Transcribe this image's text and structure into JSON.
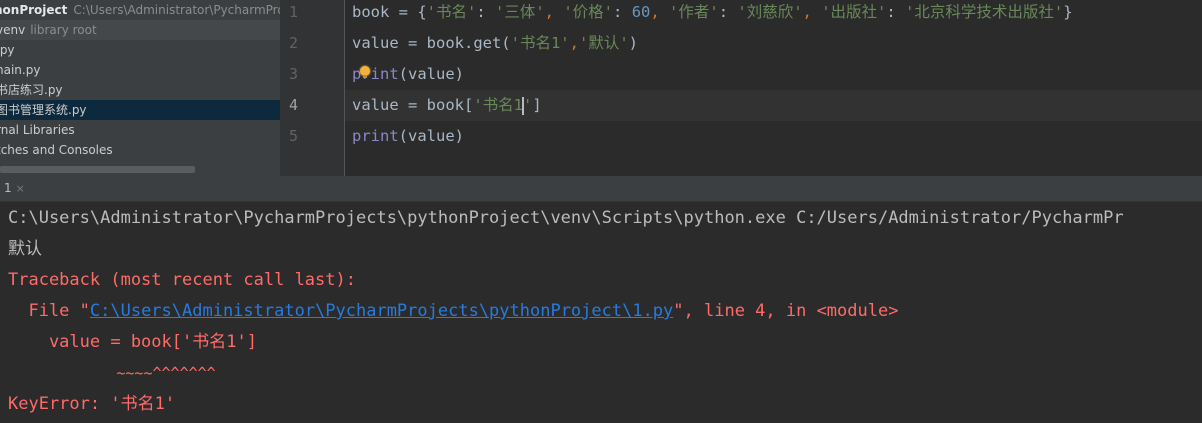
{
  "project": {
    "root_name": "honProject",
    "root_path": "C:\\Users\\Administrator\\PycharmProj",
    "items": [
      {
        "label": "venv",
        "suffix": "library root"
      },
      {
        "label": ".py"
      },
      {
        "label": "nain.py"
      },
      {
        "label": "书店练习.py"
      },
      {
        "label": "图书管理系统.py"
      },
      {
        "label": "rnal Libraries"
      },
      {
        "label": "tches and Consoles"
      }
    ]
  },
  "editor": {
    "line_numbers": [
      "1",
      "2",
      "3",
      "4",
      "5"
    ],
    "current_line": "4",
    "code": {
      "l1": {
        "var": "book",
        "op": " = {",
        "k1": "'书名'",
        "c1": ": ",
        "v1": "'三体'",
        "s1": ", ",
        "k2": "'价格'",
        "c2": ": ",
        "v2": "60",
        "s2": ", ",
        "k3": "'作者'",
        "c3": ": ",
        "v3": "'刘慈欣'",
        "s3": ", ",
        "k4": "'出版社'",
        "c4": ": ",
        "v4": "'北京科学技术出版社'",
        "end": "}"
      },
      "l2": {
        "pre": "value = book.get(",
        "a1": "'书名1'",
        "comma": ",",
        "a2": "'默认'",
        "end": ")"
      },
      "l3": {
        "fn": "print",
        "args": "(value)"
      },
      "l4": {
        "pre": "value = book[",
        "s_a": "'书名1",
        "s_b": "'",
        "end": "]"
      },
      "l5": {
        "fn": "print",
        "args": "(value)"
      }
    }
  },
  "run": {
    "tab_label": "1",
    "tab_close": "×",
    "console": {
      "cmd": "C:\\Users\\Administrator\\PycharmProjects\\pythonProject\\venv\\Scripts\\python.exe C:/Users/Administrator/PycharmPr",
      "out": "默认",
      "tb_head": "Traceback (most recent call last):",
      "file_pre": "  File \"",
      "file_link": "C:\\Users\\Administrator\\PycharmProjects\\pythonProject\\1.py",
      "file_post": "\", line 4, in <module>",
      "code_line": "    value = book['书名1']",
      "caret_line": "            ~~~~^^^^^^^",
      "error": "KeyError: '书名1'"
    }
  },
  "colors": {
    "background": "#2b2b2b",
    "panel": "#3c3f41",
    "error": "#ff6b68",
    "link": "#287bde",
    "string": "#6a8759",
    "number": "#6897bb",
    "builtin": "#8888c6"
  }
}
